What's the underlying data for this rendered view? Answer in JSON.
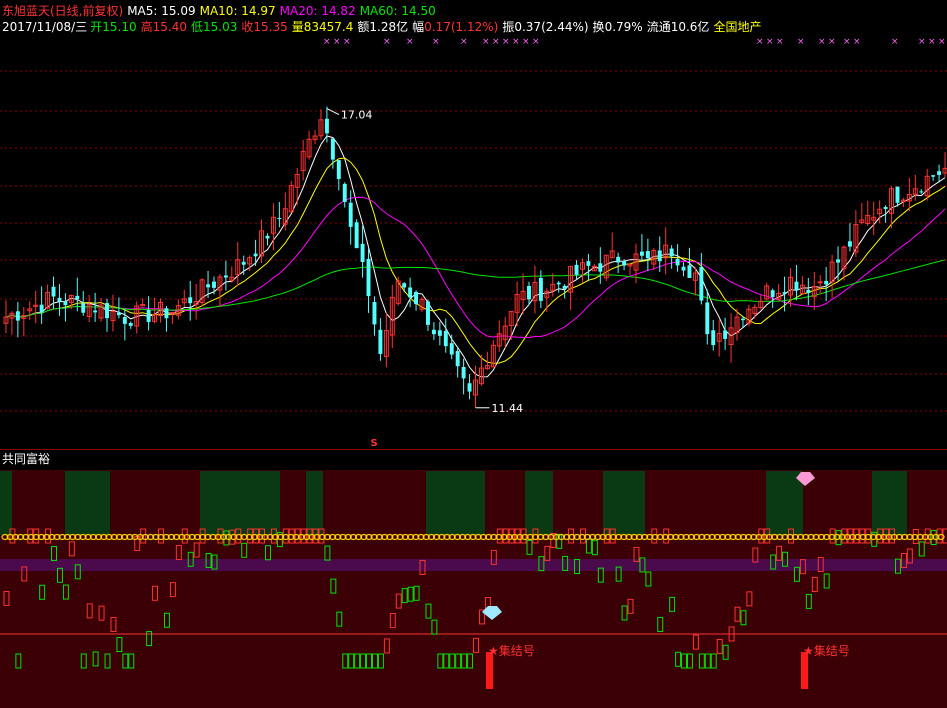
{
  "stock": {
    "name": "东旭蓝天(日线,前复权)",
    "ma5": "MA5: 15.09",
    "ma10": "MA10: 14.97",
    "ma20": "MA20: 14.82",
    "ma60": "MA60: 14.50"
  },
  "quote": {
    "date": "2017/11/08/三",
    "open_label": "开",
    "open": "15.10",
    "high_label": "高",
    "high": "15.40",
    "low_label": "低",
    "low": "15.03",
    "close_label": "收",
    "close": "15.35",
    "vol_label": "量",
    "vol": "83457.4",
    "amount_label": "额",
    "amount": "1.28亿",
    "change_label": "幅",
    "change": "0.17(1.12%)",
    "amp_label": "振",
    "amp": "0.37(2.44%)",
    "turnover_label": "换",
    "turnover": "0.79%",
    "float_label": "流通",
    "float": "10.6亿",
    "sector": "全国地产"
  },
  "markers": {
    "high_label": "17.04",
    "low_label": "11.44",
    "s_marker": "S"
  },
  "indicator": {
    "title": "共同富裕",
    "signal1": "★集结号",
    "signal2": "★集结号"
  },
  "colors": {
    "background": "#000000",
    "up": "#ff3232",
    "down": "#54ffff",
    "ma5": "#ffffff",
    "ma10": "#ffff00",
    "ma20": "#ff00ff",
    "ma60": "#00e600",
    "grid": "#8b0000",
    "ind_red": "#ff3232",
    "ind_green": "#00e600"
  },
  "chart_data": {
    "type": "candlestick",
    "price_range": [
      11.0,
      17.5
    ],
    "high_point": 17.04,
    "low_point": 11.44,
    "last_candle": {
      "open": 15.1,
      "high": 15.4,
      "low": 15.03,
      "close": 15.35
    },
    "ma_values": {
      "MA5": 15.09,
      "MA10": 14.97,
      "MA20": 14.82,
      "MA60": 14.5
    }
  }
}
